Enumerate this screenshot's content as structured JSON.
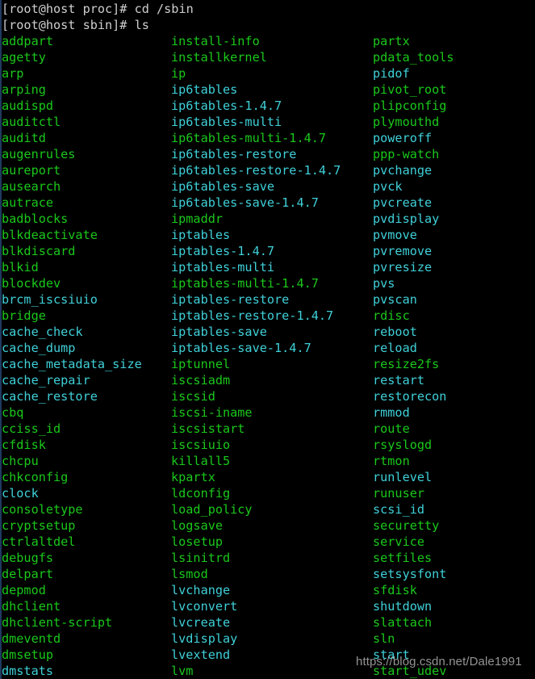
{
  "terminal": {
    "background_color": "#000000",
    "prompt_color": "#cfcfcf",
    "exec_color": "#1bc81b",
    "symlink_color": "#3fd0d8",
    "prompt_lines": [
      "[root@host proc]# cd /sbin",
      "[root@host sbin]# ls"
    ],
    "command_current": "ls",
    "working_directory": "/sbin",
    "watermark": "https://blog.csdn.net/Dale1991",
    "columns": [
      {
        "name": "column-1",
        "entries": [
          {
            "label": "addpart",
            "kind": "exec"
          },
          {
            "label": "agetty",
            "kind": "exec"
          },
          {
            "label": "arp",
            "kind": "exec"
          },
          {
            "label": "arping",
            "kind": "exec"
          },
          {
            "label": "audispd",
            "kind": "exec"
          },
          {
            "label": "auditctl",
            "kind": "exec"
          },
          {
            "label": "auditd",
            "kind": "exec"
          },
          {
            "label": "augenrules",
            "kind": "exec"
          },
          {
            "label": "aureport",
            "kind": "exec"
          },
          {
            "label": "ausearch",
            "kind": "exec"
          },
          {
            "label": "autrace",
            "kind": "exec"
          },
          {
            "label": "badblocks",
            "kind": "exec"
          },
          {
            "label": "blkdeactivate",
            "kind": "exec"
          },
          {
            "label": "blkdiscard",
            "kind": "exec"
          },
          {
            "label": "blkid",
            "kind": "exec"
          },
          {
            "label": "blockdev",
            "kind": "exec"
          },
          {
            "label": "brcm_iscsiuio",
            "kind": "link"
          },
          {
            "label": "bridge",
            "kind": "exec"
          },
          {
            "label": "cache_check",
            "kind": "link"
          },
          {
            "label": "cache_dump",
            "kind": "link"
          },
          {
            "label": "cache_metadata_size",
            "kind": "link"
          },
          {
            "label": "cache_repair",
            "kind": "link"
          },
          {
            "label": "cache_restore",
            "kind": "link"
          },
          {
            "label": "cbq",
            "kind": "exec"
          },
          {
            "label": "cciss_id",
            "kind": "exec"
          },
          {
            "label": "cfdisk",
            "kind": "exec"
          },
          {
            "label": "chcpu",
            "kind": "exec"
          },
          {
            "label": "chkconfig",
            "kind": "exec"
          },
          {
            "label": "clock",
            "kind": "link"
          },
          {
            "label": "consoletype",
            "kind": "exec"
          },
          {
            "label": "cryptsetup",
            "kind": "exec"
          },
          {
            "label": "ctrlaltdel",
            "kind": "exec"
          },
          {
            "label": "debugfs",
            "kind": "exec"
          },
          {
            "label": "delpart",
            "kind": "exec"
          },
          {
            "label": "depmod",
            "kind": "exec"
          },
          {
            "label": "dhclient",
            "kind": "exec"
          },
          {
            "label": "dhclient-script",
            "kind": "exec"
          },
          {
            "label": "dmeventd",
            "kind": "exec"
          },
          {
            "label": "dmsetup",
            "kind": "exec"
          },
          {
            "label": "dmstats",
            "kind": "link"
          }
        ]
      },
      {
        "name": "column-2",
        "entries": [
          {
            "label": "install-info",
            "kind": "exec"
          },
          {
            "label": "installkernel",
            "kind": "exec"
          },
          {
            "label": "ip",
            "kind": "exec"
          },
          {
            "label": "ip6tables",
            "kind": "link"
          },
          {
            "label": "ip6tables-1.4.7",
            "kind": "link"
          },
          {
            "label": "ip6tables-multi",
            "kind": "link"
          },
          {
            "label": "ip6tables-multi-1.4.7",
            "kind": "exec"
          },
          {
            "label": "ip6tables-restore",
            "kind": "link"
          },
          {
            "label": "ip6tables-restore-1.4.7",
            "kind": "link"
          },
          {
            "label": "ip6tables-save",
            "kind": "link"
          },
          {
            "label": "ip6tables-save-1.4.7",
            "kind": "link"
          },
          {
            "label": "ipmaddr",
            "kind": "exec"
          },
          {
            "label": "iptables",
            "kind": "link"
          },
          {
            "label": "iptables-1.4.7",
            "kind": "link"
          },
          {
            "label": "iptables-multi",
            "kind": "link"
          },
          {
            "label": "iptables-multi-1.4.7",
            "kind": "exec"
          },
          {
            "label": "iptables-restore",
            "kind": "link"
          },
          {
            "label": "iptables-restore-1.4.7",
            "kind": "link"
          },
          {
            "label": "iptables-save",
            "kind": "link"
          },
          {
            "label": "iptables-save-1.4.7",
            "kind": "link"
          },
          {
            "label": "iptunnel",
            "kind": "exec"
          },
          {
            "label": "iscsiadm",
            "kind": "exec"
          },
          {
            "label": "iscsid",
            "kind": "exec"
          },
          {
            "label": "iscsi-iname",
            "kind": "exec"
          },
          {
            "label": "iscsistart",
            "kind": "exec"
          },
          {
            "label": "iscsiuio",
            "kind": "exec"
          },
          {
            "label": "killall5",
            "kind": "exec"
          },
          {
            "label": "kpartx",
            "kind": "exec"
          },
          {
            "label": "ldconfig",
            "kind": "exec"
          },
          {
            "label": "load_policy",
            "kind": "exec"
          },
          {
            "label": "logsave",
            "kind": "exec"
          },
          {
            "label": "losetup",
            "kind": "exec"
          },
          {
            "label": "lsinitrd",
            "kind": "exec"
          },
          {
            "label": "lsmod",
            "kind": "exec"
          },
          {
            "label": "lvchange",
            "kind": "link"
          },
          {
            "label": "lvconvert",
            "kind": "link"
          },
          {
            "label": "lvcreate",
            "kind": "link"
          },
          {
            "label": "lvdisplay",
            "kind": "link"
          },
          {
            "label": "lvextend",
            "kind": "link"
          },
          {
            "label": "lvm",
            "kind": "exec"
          }
        ]
      },
      {
        "name": "column-3",
        "entries": [
          {
            "label": "partx",
            "kind": "exec"
          },
          {
            "label": "pdata_tools",
            "kind": "exec"
          },
          {
            "label": "pidof",
            "kind": "link"
          },
          {
            "label": "pivot_root",
            "kind": "exec"
          },
          {
            "label": "plipconfig",
            "kind": "exec"
          },
          {
            "label": "plymouthd",
            "kind": "exec"
          },
          {
            "label": "poweroff",
            "kind": "link"
          },
          {
            "label": "ppp-watch",
            "kind": "exec"
          },
          {
            "label": "pvchange",
            "kind": "link"
          },
          {
            "label": "pvck",
            "kind": "link"
          },
          {
            "label": "pvcreate",
            "kind": "link"
          },
          {
            "label": "pvdisplay",
            "kind": "link"
          },
          {
            "label": "pvmove",
            "kind": "link"
          },
          {
            "label": "pvremove",
            "kind": "link"
          },
          {
            "label": "pvresize",
            "kind": "link"
          },
          {
            "label": "pvs",
            "kind": "link"
          },
          {
            "label": "pvscan",
            "kind": "link"
          },
          {
            "label": "rdisc",
            "kind": "exec"
          },
          {
            "label": "reboot",
            "kind": "link"
          },
          {
            "label": "reload",
            "kind": "link"
          },
          {
            "label": "resize2fs",
            "kind": "exec"
          },
          {
            "label": "restart",
            "kind": "link"
          },
          {
            "label": "restorecon",
            "kind": "link"
          },
          {
            "label": "rmmod",
            "kind": "link"
          },
          {
            "label": "route",
            "kind": "exec"
          },
          {
            "label": "rsyslogd",
            "kind": "exec"
          },
          {
            "label": "rtmon",
            "kind": "exec"
          },
          {
            "label": "runlevel",
            "kind": "link"
          },
          {
            "label": "runuser",
            "kind": "exec"
          },
          {
            "label": "scsi_id",
            "kind": "link"
          },
          {
            "label": "securetty",
            "kind": "exec"
          },
          {
            "label": "service",
            "kind": "exec"
          },
          {
            "label": "setfiles",
            "kind": "exec"
          },
          {
            "label": "setsysfont",
            "kind": "link"
          },
          {
            "label": "sfdisk",
            "kind": "exec"
          },
          {
            "label": "shutdown",
            "kind": "link"
          },
          {
            "label": "slattach",
            "kind": "exec"
          },
          {
            "label": "sln",
            "kind": "exec"
          },
          {
            "label": "start",
            "kind": "link"
          },
          {
            "label": "start_udev",
            "kind": "exec"
          }
        ]
      }
    ]
  }
}
